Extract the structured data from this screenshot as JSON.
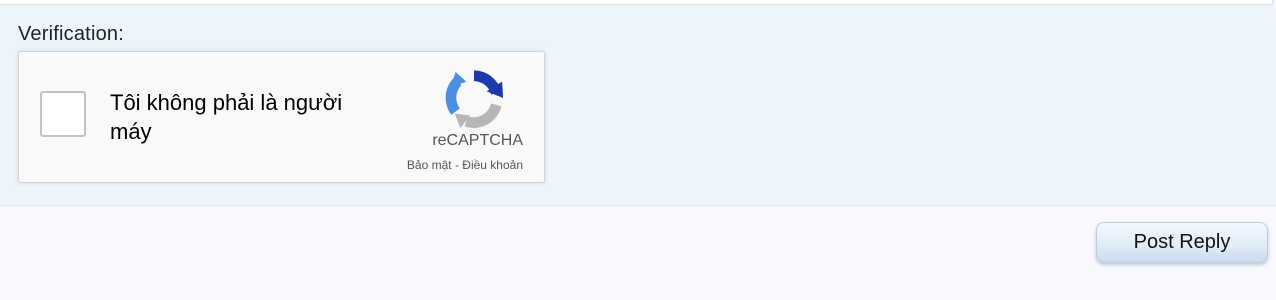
{
  "form": {
    "verification_label": "Verification:"
  },
  "recaptcha": {
    "label": "Tôi không phải là người máy",
    "brand": "reCAPTCHA",
    "privacy_link": "Bảo mật",
    "separator": " - ",
    "terms_link": "Điều khoản",
    "checked": false,
    "logo_icon": "recaptcha-logo-icon",
    "colors": {
      "arrow_blue": "#4a90e2",
      "arrow_dark_blue": "#1c3aa9",
      "arrow_gray": "#b7b7b7"
    }
  },
  "actions": {
    "post_reply_label": "Post Reply"
  }
}
